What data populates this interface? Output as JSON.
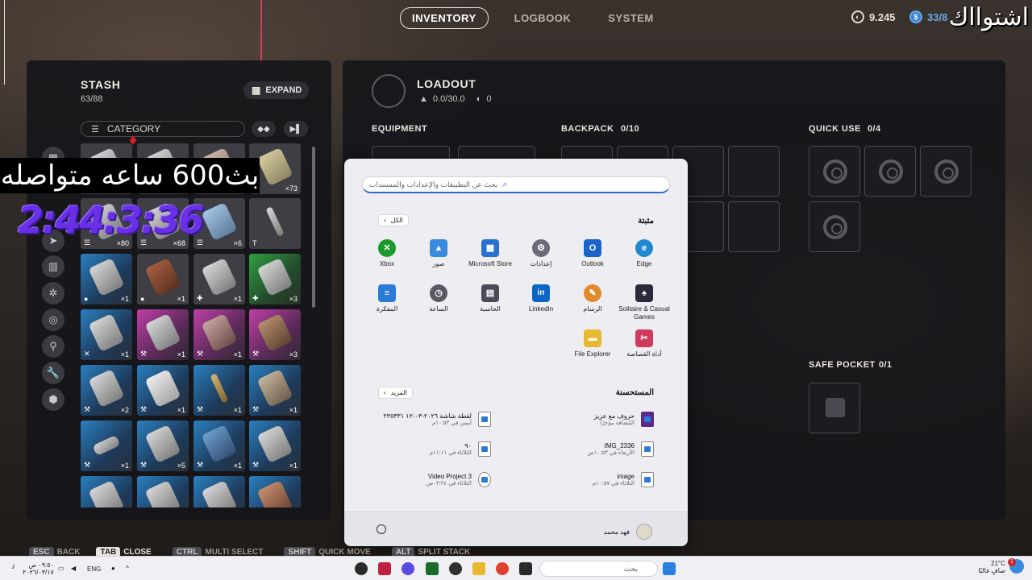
{
  "topnav": {
    "tabs": [
      {
        "label": "INVENTORY",
        "active": true
      },
      {
        "label": "LOGBOOK",
        "active": false
      },
      {
        "label": "SYSTEM",
        "active": false
      }
    ],
    "coins": "9.245",
    "credits": "33/8"
  },
  "watermark": "اشتوااك",
  "stash": {
    "title": "STASH",
    "capacity": "63/88",
    "expand_label": "EXPAND",
    "category_label": "CATEGORY",
    "counts": [
      "×73",
      "×80",
      "×68",
      "×6",
      "×1",
      "×1",
      "×1",
      "×3",
      "×1",
      "×1",
      "×1",
      "×3",
      "×2",
      "×1",
      "×1",
      "×1",
      "×1",
      "×5",
      "×1",
      "×1"
    ]
  },
  "loadout": {
    "title": "LOADOUT",
    "weight": "0.0/30.0",
    "value": "0",
    "equipment_label": "EQUIPMENT",
    "backpack_label": "BACKPACK",
    "backpack_count": "0/10",
    "quickuse_label": "QUICK USE",
    "quickuse_count": "0/4",
    "safepocket_label": "SAFE POCKET",
    "safepocket_count": "0/1"
  },
  "overlay": {
    "stream_text": "بث600 ساعه متواصله",
    "stream_counter": "2:44:3:36"
  },
  "start_menu": {
    "search_placeholder": "بحث عن التطبيقات والإعدادات والمستندات",
    "pinned_title": "مثبتة",
    "all_label": "الكل",
    "apps": [
      {
        "name": "Edge",
        "color": "#1e88d0",
        "glyph": "e"
      },
      {
        "name": "Outlook",
        "color": "#1a64c8",
        "glyph": "O"
      },
      {
        "name": "إعدادات",
        "color": "#6a6a78",
        "glyph": "⚙"
      },
      {
        "name": "Microsoft Store",
        "color": "#2a70d0",
        "glyph": "▦"
      },
      {
        "name": "صور",
        "color": "#3a8ae0",
        "glyph": "▲"
      },
      {
        "name": "Xbox",
        "color": "#1a9a2a",
        "glyph": "✕"
      },
      {
        "name": "Solitaire & Casual Games",
        "color": "#2a2a3a",
        "glyph": "♠"
      },
      {
        "name": "الرسام",
        "color": "#e08a2a",
        "glyph": "✎"
      },
      {
        "name": "LinkedIn",
        "color": "#0a66c2",
        "glyph": "in"
      },
      {
        "name": "الحاسبة",
        "color": "#4a4a58",
        "glyph": "▤"
      },
      {
        "name": "الساعة",
        "color": "#5a5a66",
        "glyph": "◷"
      },
      {
        "name": "المفكرة",
        "color": "#2a7ad8",
        "glyph": "≡"
      },
      {
        "name": "أداة القصاصة",
        "color": "#d03a5a",
        "glyph": "✂"
      },
      {
        "name": "File Explorer",
        "color": "#e8b830",
        "glyph": "▬"
      }
    ],
    "recommended_title": "المستحسنة",
    "more_label": "المزيد",
    "recommended": [
      {
        "title": "حروف مع عزيز",
        "sub": "المُضافة مؤخرًا"
      },
      {
        "title": "لقطة شاشة ٢٠٢٦-٠٣-١٢ ٢٣٥٣٣١",
        "sub": "أمس في ١٠:٥٣م"
      },
      {
        "title": "IMG_2336",
        "sub": "الأربعاء في ١٠:٥٣ص"
      },
      {
        "title": "٩٠",
        "sub": "الثلاثاء في ١١:١١م"
      },
      {
        "title": "image",
        "sub": "الثلاثاء في ١٠:٥٧م"
      },
      {
        "title": "Video Project 3",
        "sub": "الثلاثاء في ٠٣:٢٤ص"
      }
    ],
    "user_name": "فهد محمد"
  },
  "hints": [
    {
      "key": "ESC",
      "label": "BACK"
    },
    {
      "key": "TAB",
      "label": "CLOSE"
    },
    {
      "key": "CTRL",
      "label": "MULTI SELECT"
    },
    {
      "key": "SHIFT",
      "label": "QUICK MOVE"
    },
    {
      "key": "ALT",
      "label": "SPLIT STACK"
    }
  ],
  "taskbar": {
    "time": "٠٩:٥٠ ص",
    "date": "٢٠٢٦/٠٣/١٧",
    "lang": "ENG",
    "search_placeholder": "بحث",
    "weather_temp": "21°C",
    "weather_desc": "صافٍ غالبًا",
    "notif_count": "1"
  }
}
